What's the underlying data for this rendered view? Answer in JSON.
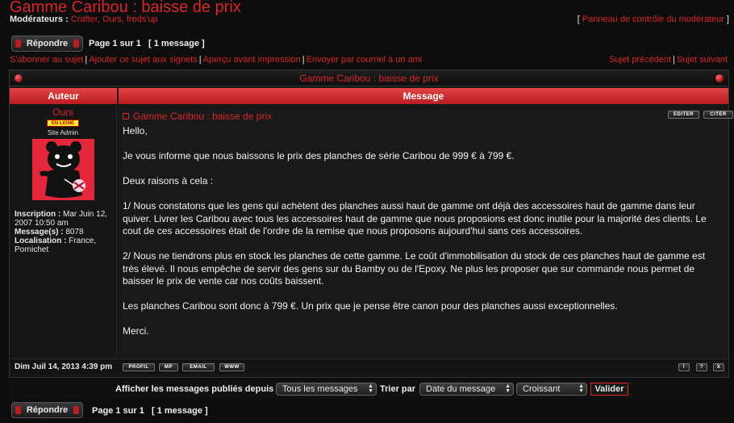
{
  "topic": {
    "title": "Gamme Caribou : baisse de prix",
    "moderators_label": "Modérateurs :",
    "moderators": [
      "Crafter",
      "Ours",
      "freds'up"
    ],
    "mod_panel": "Panneau de contrôle du modérateur"
  },
  "pagination": {
    "reply_label": "Répondre",
    "page_text": "Page 1 sur 1",
    "count_text": "[ 1 message ]"
  },
  "actions": [
    "S'abonner au sujet",
    "Ajouter ce sujet aux signets",
    "Aperçu avant impression",
    "Envoyer par courriel à un ami"
  ],
  "nav": {
    "prev": "Sujet précédent",
    "next": "Sujet suivant"
  },
  "table": {
    "caption": "Gamme Caribou : baisse de prix",
    "col_author": "Auteur",
    "col_message": "Message"
  },
  "post": {
    "author": "Ours",
    "online_badge": "EN LIGNE",
    "rank": "Site Admin",
    "inscription_label": "Inscription :",
    "inscription_value": "Mar Juin 12, 2007 10:50 am",
    "messages_label": "Message(s) :",
    "messages_value": "8078",
    "location_label": "Localisation :",
    "location_value": "France, Pornichet",
    "subject": "Gamme Caribou : baisse de prix",
    "edit_label": "EDITER",
    "quote_label": "CITER",
    "body": [
      "Hello,",
      "Je vous informe que nous baissons le prix des planches de série Caribou de 999 € à 799 €.",
      "Deux raisons à cela :",
      "1/ Nous constatons que les gens qui achètent des planches aussi haut de gamme ont déjà des accessoires haut de gamme dans leur quiver. Livrer les Caribou avec tous les accessoires haut de gamme que nous proposions est donc inutile pour la majorité des clients. Le cout de ces accessoires était de l'ordre de la remise que nous proposons aujourd'hui sans ces accessoires.",
      "2/ Nous ne tiendrons plus en stock les planches de cette gamme. Le coût d'immobilisation du stock de ces planches haut de gamme est très élevé. Il nous empêche de servir des gens sur du Bamby ou de l'Epoxy. Ne plus les proposer que sur commande nous permet de baisser le prix de vente car nos coûts baissent.",
      "Les planches Caribou sont donc à 799 €. Un prix que je pense être canon pour des planches aussi exceptionnelles.",
      "Merci."
    ],
    "date": "Dim Juil 14, 2013 4:39 pm",
    "profile_btns": [
      "PROFIL",
      "MP",
      "EMAIL",
      "WWW"
    ],
    "mod_btns": [
      "!",
      "?",
      "X"
    ]
  },
  "sort": {
    "show_label": "Afficher les messages publiés depuis :",
    "show_value": "Tous les messages",
    "sort_label": "Trier par",
    "sort_value": "Date du message",
    "order_value": "Croissant",
    "submit": "Valider"
  },
  "colors": {
    "accent": "#d8262a",
    "header_red": "#c62326",
    "background": "#0d0d0d",
    "badge_yellow": "#ffec2e"
  }
}
